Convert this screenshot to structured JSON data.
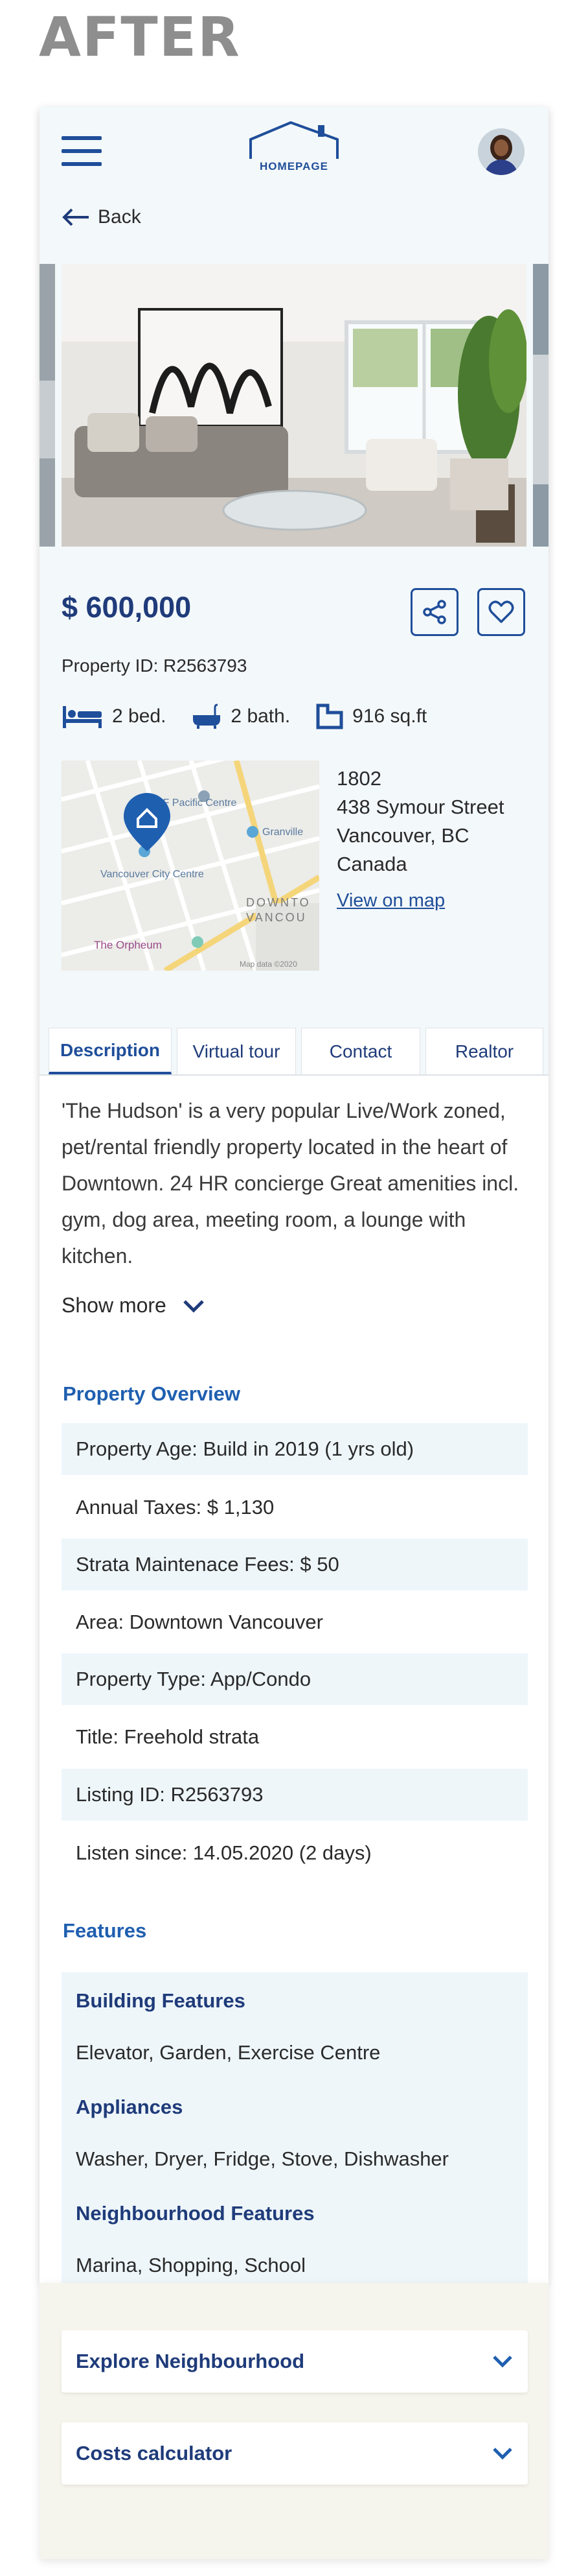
{
  "banner": {
    "title": "AFTER"
  },
  "header": {
    "logo_text": "HOMEPAGE"
  },
  "nav": {
    "back_label": "Back"
  },
  "listing": {
    "price": "$ 600,000",
    "property_id": "Property ID: R2563793",
    "beds": "2 bed.",
    "baths": "2 bath.",
    "area": "916 sq.ft",
    "address": {
      "unit": "1802",
      "street": "438 Symour Street",
      "city": "Vancouver, BC",
      "country": "Canada",
      "view_map": "View on map"
    }
  },
  "map": {
    "labels": [
      "CF Pacific Centre",
      "Granville",
      "Vancouver City Centre",
      "DOWNTO",
      "VANCOU",
      "The Orpheum",
      "Map data ©2020"
    ]
  },
  "tabs": [
    "Description",
    "Virtual tour",
    "Contact",
    "Realtor"
  ],
  "description": {
    "text": "'The Hudson' is a very popular Live/Work zoned, pet/rental friendly property located in the heart of Downtown. 24 HR concierge Great amenities incl. gym, dog area, meeting room, a lounge with kitchen.",
    "show_more": "Show more"
  },
  "overview": {
    "title": "Property Overview",
    "rows": [
      "Property Age: Build in 2019 (1 yrs old)",
      "Annual Taxes: $ 1,130",
      "Strata Maintenace Fees: $ 50",
      "Area: Downtown Vancouver",
      "Property Type: App/Condo",
      "Title: Freehold strata",
      "Listing ID: R2563793",
      "Listen since: 14.05.2020 (2 days)"
    ]
  },
  "features": {
    "title": "Features",
    "groups": [
      {
        "heading": "Building Features",
        "value": "Elevator, Garden, Exercise Centre"
      },
      {
        "heading": "Appliances",
        "value": "Washer, Dryer, Fridge, Stove, Dishwasher"
      },
      {
        "heading": "Neighbourhood Features",
        "value": "Marina, Shopping, School"
      }
    ]
  },
  "accordions": [
    "Explore Neighbourhood",
    "Costs calculator"
  ],
  "colors": {
    "primary": "#1f4e9a",
    "heading": "#1f3b7a",
    "accent_blue": "#1f5fb0",
    "row_shade": "#eef6fa"
  }
}
